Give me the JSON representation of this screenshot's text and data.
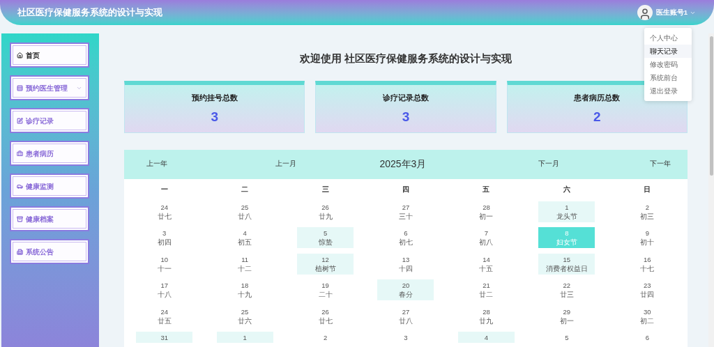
{
  "header": {
    "title": "社区医疗保健服务系统的设计与实现",
    "user": "医生账号1"
  },
  "user_menu": [
    {
      "label": "个人中心",
      "hovered": false
    },
    {
      "label": "聊天记录",
      "hovered": true
    },
    {
      "label": "修改密码",
      "hovered": false
    },
    {
      "label": "系统前台",
      "hovered": false
    },
    {
      "label": "退出登录",
      "hovered": false
    }
  ],
  "sidebar": {
    "items": [
      {
        "label": "首页",
        "selected": true,
        "expandable": false
      },
      {
        "label": "预约医生管理",
        "selected": false,
        "expandable": true
      },
      {
        "label": "诊疗记录",
        "selected": false,
        "expandable": false
      },
      {
        "label": "患者病历",
        "selected": false,
        "expandable": false
      },
      {
        "label": "健康监测",
        "selected": false,
        "expandable": false
      },
      {
        "label": "健康档案",
        "selected": false,
        "expandable": false
      },
      {
        "label": "系统公告",
        "selected": false,
        "expandable": false
      }
    ]
  },
  "welcome": "欢迎使用 社区医疗保健服务系统的设计与实现",
  "stats": [
    {
      "label": "预约挂号总数",
      "value": "3"
    },
    {
      "label": "诊疗记录总数",
      "value": "3"
    },
    {
      "label": "患者病历总数",
      "value": "2"
    }
  ],
  "calendar": {
    "prev_year": "上一年",
    "prev_month": "上一月",
    "month": "2025年3月",
    "next_month": "下一月",
    "next_year": "下一年",
    "weekdays": [
      "一",
      "二",
      "三",
      "四",
      "五",
      "六",
      "日"
    ],
    "weeks": [
      [
        {
          "day": "24",
          "lunar": "廿七",
          "highlighted": false,
          "selected": false
        },
        {
          "day": "25",
          "lunar": "廿八",
          "highlighted": false,
          "selected": false
        },
        {
          "day": "26",
          "lunar": "廿九",
          "highlighted": false,
          "selected": false
        },
        {
          "day": "27",
          "lunar": "三十",
          "highlighted": false,
          "selected": false
        },
        {
          "day": "28",
          "lunar": "初一",
          "highlighted": false,
          "selected": false
        },
        {
          "day": "1",
          "lunar": "龙头节",
          "highlighted": true,
          "selected": false
        },
        {
          "day": "2",
          "lunar": "初三",
          "highlighted": false,
          "selected": false
        }
      ],
      [
        {
          "day": "3",
          "lunar": "初四",
          "highlighted": false,
          "selected": false
        },
        {
          "day": "4",
          "lunar": "初五",
          "highlighted": false,
          "selected": false
        },
        {
          "day": "5",
          "lunar": "惊蛰",
          "highlighted": true,
          "selected": false
        },
        {
          "day": "6",
          "lunar": "初七",
          "highlighted": false,
          "selected": false
        },
        {
          "day": "7",
          "lunar": "初八",
          "highlighted": false,
          "selected": false
        },
        {
          "day": "8",
          "lunar": "妇女节",
          "highlighted": true,
          "selected": true
        },
        {
          "day": "9",
          "lunar": "初十",
          "highlighted": false,
          "selected": false
        }
      ],
      [
        {
          "day": "10",
          "lunar": "十一",
          "highlighted": false,
          "selected": false
        },
        {
          "day": "11",
          "lunar": "十二",
          "highlighted": false,
          "selected": false
        },
        {
          "day": "12",
          "lunar": "植树节",
          "highlighted": true,
          "selected": false
        },
        {
          "day": "13",
          "lunar": "十四",
          "highlighted": false,
          "selected": false
        },
        {
          "day": "14",
          "lunar": "十五",
          "highlighted": false,
          "selected": false
        },
        {
          "day": "15",
          "lunar": "消费者权益日",
          "highlighted": true,
          "selected": false
        },
        {
          "day": "16",
          "lunar": "十七",
          "highlighted": false,
          "selected": false
        }
      ],
      [
        {
          "day": "17",
          "lunar": "十八",
          "highlighted": false,
          "selected": false
        },
        {
          "day": "18",
          "lunar": "十九",
          "highlighted": false,
          "selected": false
        },
        {
          "day": "19",
          "lunar": "二十",
          "highlighted": false,
          "selected": false
        },
        {
          "day": "20",
          "lunar": "春分",
          "highlighted": true,
          "selected": false
        },
        {
          "day": "21",
          "lunar": "廿二",
          "highlighted": false,
          "selected": false
        },
        {
          "day": "22",
          "lunar": "廿三",
          "highlighted": false,
          "selected": false
        },
        {
          "day": "23",
          "lunar": "廿四",
          "highlighted": false,
          "selected": false
        }
      ],
      [
        {
          "day": "24",
          "lunar": "廿五",
          "highlighted": false,
          "selected": false
        },
        {
          "day": "25",
          "lunar": "廿六",
          "highlighted": false,
          "selected": false
        },
        {
          "day": "26",
          "lunar": "廿七",
          "highlighted": false,
          "selected": false
        },
        {
          "day": "27",
          "lunar": "廿八",
          "highlighted": false,
          "selected": false
        },
        {
          "day": "28",
          "lunar": "廿九",
          "highlighted": false,
          "selected": false
        },
        {
          "day": "29",
          "lunar": "初一",
          "highlighted": false,
          "selected": false
        },
        {
          "day": "30",
          "lunar": "初二",
          "highlighted": false,
          "selected": false
        }
      ],
      [
        {
          "day": "31",
          "highlighted": true,
          "selected": false
        },
        {
          "day": "1",
          "highlighted": true,
          "selected": false
        },
        {
          "day": "2",
          "highlighted": false,
          "selected": false
        },
        {
          "day": "3",
          "highlighted": false,
          "selected": false
        },
        {
          "day": "4",
          "highlighted": true,
          "selected": false
        },
        {
          "day": "5",
          "highlighted": false,
          "selected": false
        },
        {
          "day": "6",
          "highlighted": false,
          "selected": false
        }
      ]
    ]
  }
}
